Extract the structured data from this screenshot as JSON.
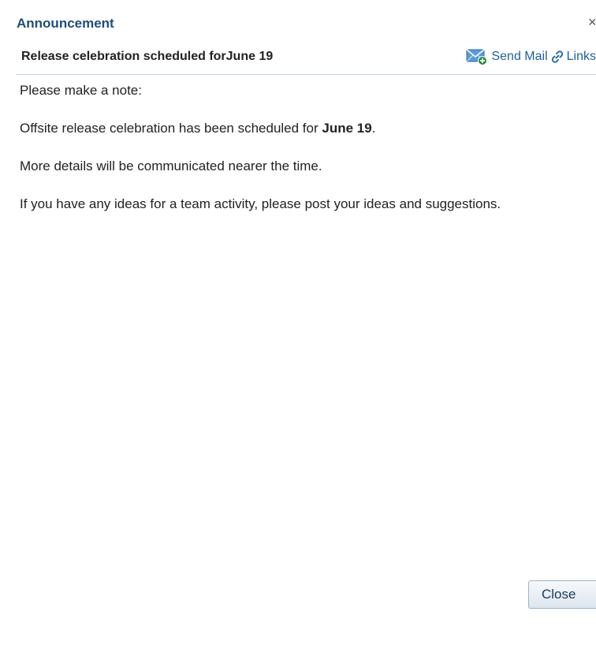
{
  "dialog": {
    "title": "Announcement",
    "close_glyph": "×"
  },
  "header": {
    "subject": "Release celebration scheduled forJune 19",
    "send_mail_label": "Send Mail",
    "links_label": "Links"
  },
  "body": {
    "line1": "Please make a note:",
    "line2_prefix": "Offsite release celebration has been scheduled for ",
    "line2_bold": "June 19",
    "line2_suffix": ".",
    "line3": "More details will be communicated nearer the time.",
    "line4": "If you have any ideas for a team activity, please post your ideas and suggestions."
  },
  "footer": {
    "close_label": "Close"
  },
  "colors": {
    "title": "#1e4e79",
    "link": "#1f5f9e",
    "divider": "#bcd0e4"
  },
  "icons": {
    "send_mail": "mail-add-icon",
    "links": "chain-link-icon",
    "close": "close-icon"
  }
}
